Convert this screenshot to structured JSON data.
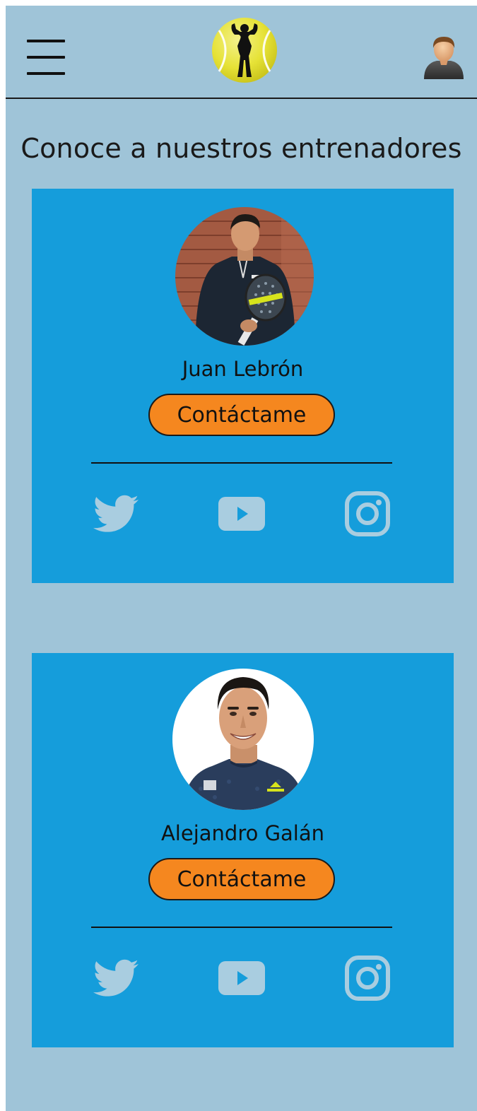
{
  "header": {
    "menu_icon": "hamburger-menu-icon",
    "logo_icon": "bodybuilder-tennis-ball-logo",
    "user_icon": "user-avatar-icon"
  },
  "page_title": "Conoce a nuestros entrenadores",
  "trainers": [
    {
      "name": "Juan Lebrón",
      "contact_label": "Contáctame",
      "photo": "trainer-photo-juan-lebron",
      "social": [
        "twitter-icon",
        "youtube-icon",
        "instagram-icon"
      ]
    },
    {
      "name": "Alejandro Galán",
      "contact_label": "Contáctame",
      "photo": "trainer-photo-alejandro-galan",
      "social": [
        "twitter-icon",
        "youtube-icon",
        "instagram-icon"
      ]
    }
  ],
  "colors": {
    "page_background": "#9fc4d8",
    "card_background": "#159ddb",
    "button_background": "#f5871f",
    "social_icon_color": "#a9cde0",
    "logo_yellow": "#e8e43a"
  }
}
